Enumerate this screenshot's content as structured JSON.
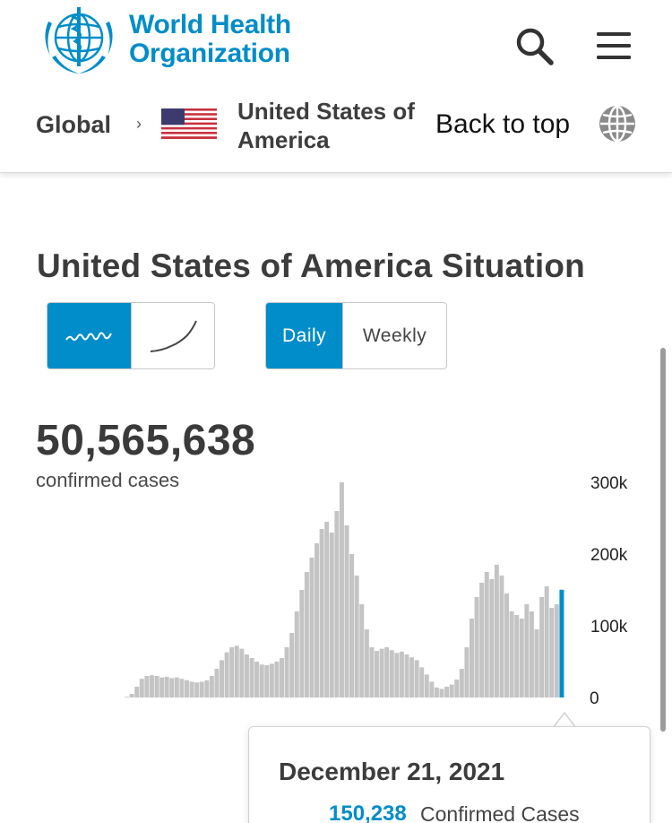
{
  "header": {
    "logo_text_line1": "World Health",
    "logo_text_line2": "Organization",
    "icons": {
      "logo": "who-emblem-icon",
      "search": "search-icon",
      "menu": "hamburger-menu-icon"
    }
  },
  "breadcrumb": {
    "global_label": "Global",
    "separator": "›",
    "country_line1": "United States of",
    "country_line2": "America",
    "back_to_top": "Back to top",
    "icons": {
      "flag": "us-flag-icon",
      "globe": "globe-icon"
    }
  },
  "situation": {
    "title": "United States of America Situation",
    "chart_type_options": [
      {
        "icon": "daily-trend-line-icon",
        "selected": true
      },
      {
        "icon": "cumulative-curve-icon",
        "selected": false
      }
    ],
    "period_options": [
      {
        "label": "Daily",
        "selected": true
      },
      {
        "label": "Weekly",
        "selected": false
      }
    ],
    "total_count": "50,565,638",
    "total_label": "confirmed cases"
  },
  "tooltip": {
    "date": "December 21, 2021",
    "value": "150,238",
    "label": "Confirmed Cases"
  },
  "colors": {
    "accent": "#008dc9",
    "bars": "#c4c4c4",
    "highlight_bar": "#008dc9",
    "text": "#3a3a3a"
  },
  "chart_data": {
    "type": "bar",
    "title": "",
    "xlabel": "",
    "ylabel": "",
    "ylim": [
      0,
      300000
    ],
    "y_ticks": [
      "0",
      "100k",
      "200k",
      "300k"
    ],
    "y_tick_values": [
      0,
      100000,
      200000,
      300000
    ],
    "x_start": "2020-01-22",
    "x_end": "2021-12-21",
    "description_note": "daily confirmed cases, weekly-ish sampled profile",
    "series": [
      {
        "values": [
          0,
          0,
          0,
          0,
          0,
          0,
          0,
          1000,
          5000,
          15000,
          26000,
          30000,
          31000,
          30000,
          28000,
          29000,
          27000,
          28000,
          26000,
          24000,
          22000,
          21000,
          22000,
          24000,
          30000,
          40000,
          52000,
          63000,
          70000,
          72000,
          68000,
          60000,
          55000,
          50000,
          46000,
          45000,
          47000,
          50000,
          55000,
          70000,
          90000,
          120000,
          150000,
          175000,
          195000,
          215000,
          235000,
          245000,
          230000,
          260000,
          300000,
          240000,
          200000,
          170000,
          130000,
          95000,
          70000,
          65000,
          68000,
          70000,
          66000,
          62000,
          64000,
          60000,
          56000,
          52000,
          42000,
          32000,
          22000,
          14000,
          12000,
          15000,
          18000,
          25000,
          40000,
          70000,
          110000,
          140000,
          160000,
          175000,
          165000,
          185000,
          170000,
          145000,
          120000,
          115000,
          110000,
          130000,
          120000,
          95000,
          140000,
          155000,
          125000,
          130000,
          150238
        ]
      }
    ],
    "highlight": {
      "date": "December 21, 2021",
      "value": 150238
    }
  }
}
